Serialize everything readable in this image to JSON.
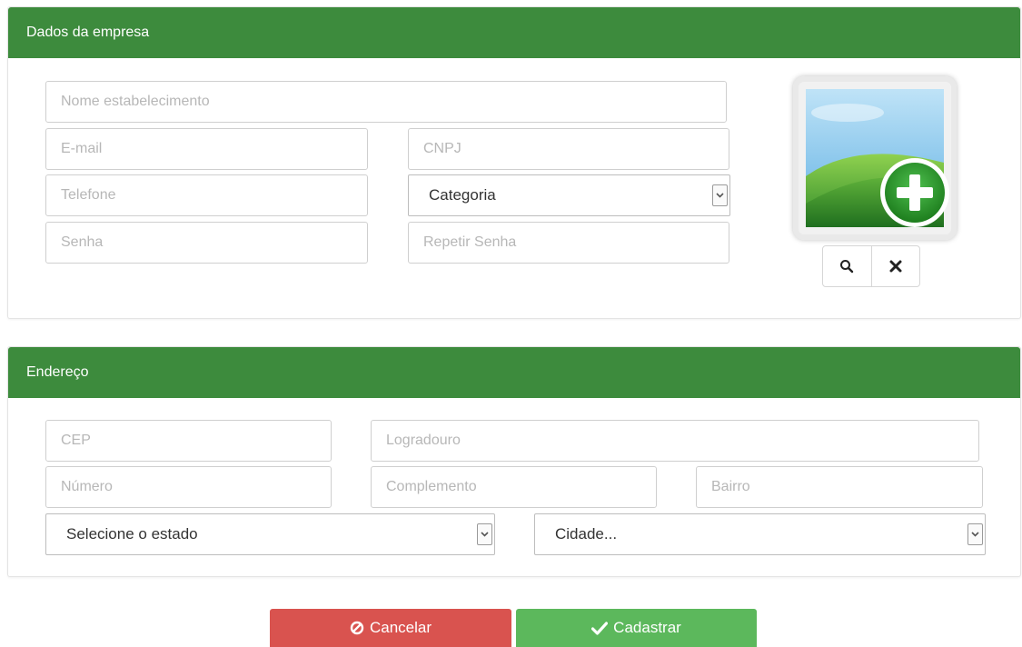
{
  "company": {
    "heading": "Dados da empresa",
    "name_placeholder": "Nome estabelecimento",
    "email_placeholder": "E-mail",
    "cnpj_placeholder": "CNPJ",
    "phone_placeholder": "Telefone",
    "category_selected": "Categoria",
    "password_placeholder": "Senha",
    "repeat_password_placeholder": "Repetir Senha",
    "image_buttons": [
      {
        "icon": "search-icon"
      },
      {
        "icon": "close-icon"
      }
    ]
  },
  "address": {
    "heading": "Endereço",
    "cep_placeholder": "CEP",
    "street_placeholder": "Logradouro",
    "number_placeholder": "Número",
    "complement_placeholder": "Complemento",
    "district_placeholder": "Bairro",
    "state_selected": "Selecione o estado",
    "city_selected": "Cidade..."
  },
  "actions": {
    "cancel_label": "Cancelar",
    "cancel_icon": "ban-icon",
    "submit_label": "Cadastrar",
    "submit_icon": "check-icon"
  },
  "colors": {
    "header_green": "#3d8b3d",
    "cancel_red": "#d9534f",
    "submit_green": "#5cb85c"
  }
}
